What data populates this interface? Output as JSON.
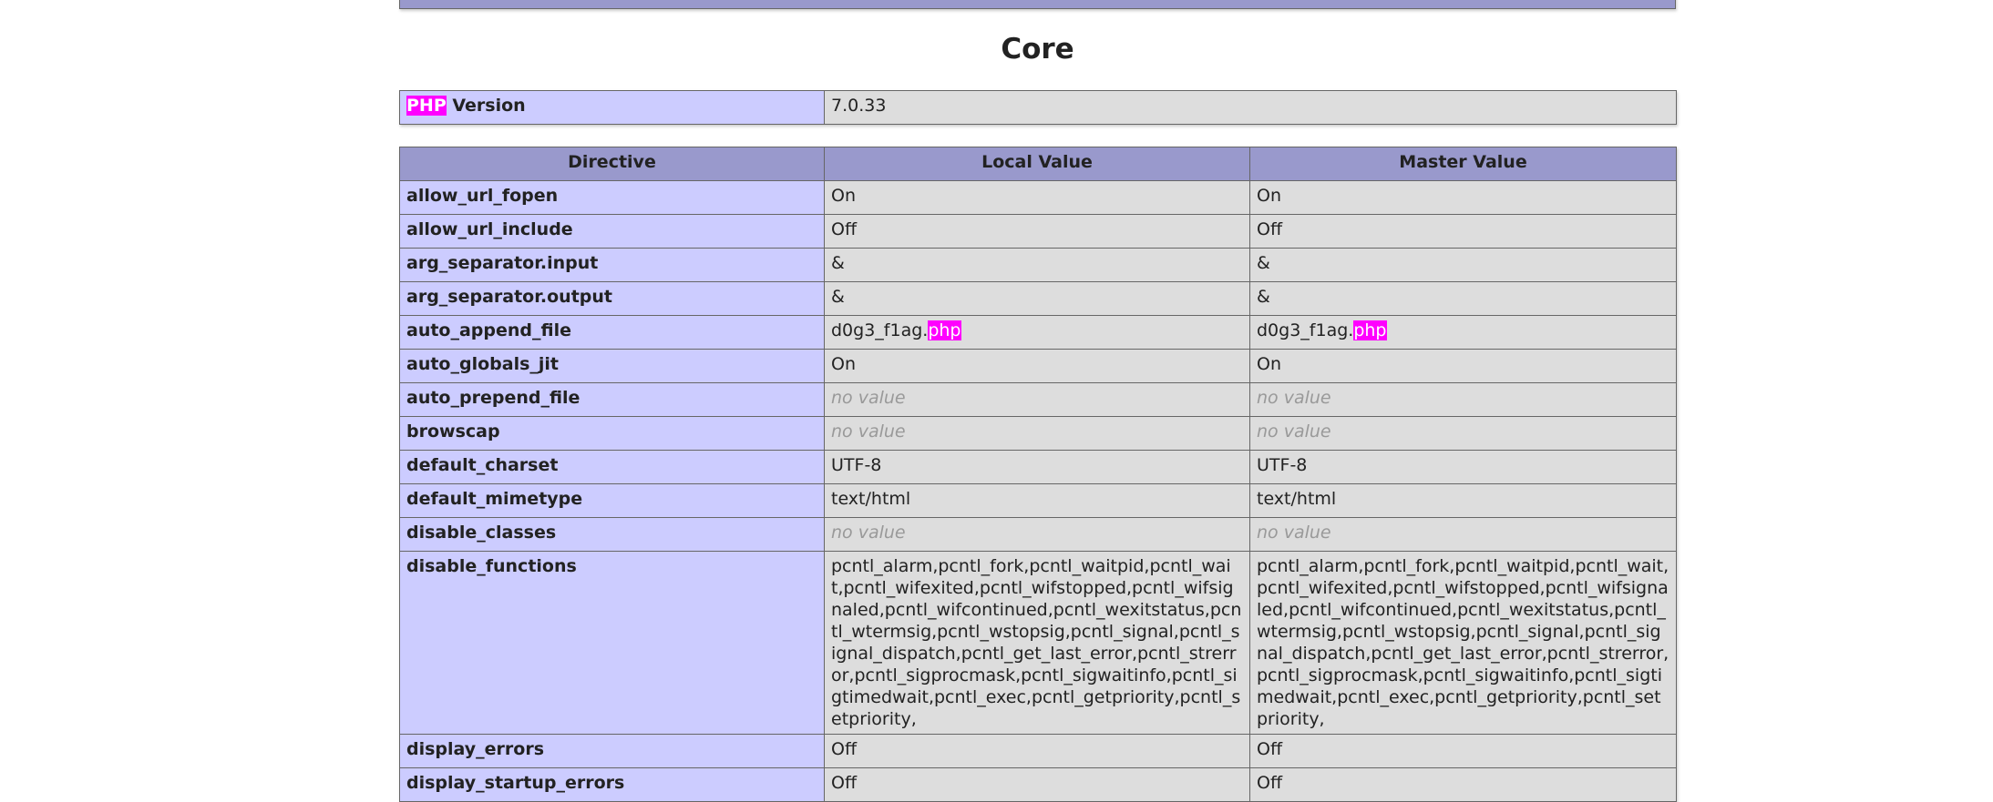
{
  "section": {
    "title": "Core"
  },
  "version": {
    "label_highlight": "PHP",
    "label_rest": " Version",
    "value": "7.0.33"
  },
  "table": {
    "headers": [
      "Directive",
      "Local Value",
      "Master Value"
    ],
    "no_value": "no value",
    "rows": [
      {
        "name": "allow_url_fopen",
        "local": "On",
        "master": "On"
      },
      {
        "name": "allow_url_include",
        "local": "Off",
        "master": "Off"
      },
      {
        "name": "arg_separator.input",
        "local": "&",
        "master": "&"
      },
      {
        "name": "arg_separator.output",
        "local": "&",
        "master": "&"
      },
      {
        "name": "auto_append_file",
        "local_prefix": "d0g3_f1ag.",
        "local_hl": "php",
        "master_prefix": "d0g3_f1ag.",
        "master_hl": "php"
      },
      {
        "name": "auto_globals_jit",
        "local": "On",
        "master": "On"
      },
      {
        "name": "auto_prepend_file",
        "local": "no value",
        "master": "no value"
      },
      {
        "name": "browscap",
        "local": "no value",
        "master": "no value"
      },
      {
        "name": "default_charset",
        "local": "UTF-8",
        "master": "UTF-8"
      },
      {
        "name": "default_mimetype",
        "local": "text/html",
        "master": "text/html"
      },
      {
        "name": "disable_classes",
        "local": "no value",
        "master": "no value"
      },
      {
        "name": "disable_functions",
        "local": "pcntl_alarm,pcntl_fork,pcntl_waitpid,pcntl_wait,pcntl_wifexited,pcntl_wifstopped,pcntl_wifsignaled,pcntl_wifcontinued,pcntl_wexitstatus,pcntl_wtermsig,pcntl_wstopsig,pcntl_signal,pcntl_signal_dispatch,pcntl_get_last_error,pcntl_strerror,pcntl_sigprocmask,pcntl_sigwaitinfo,pcntl_sigtimedwait,pcntl_exec,pcntl_getpriority,pcntl_setpriority,",
        "master": "pcntl_alarm,pcntl_fork,pcntl_waitpid,pcntl_wait,pcntl_wifexited,pcntl_wifstopped,pcntl_wifsignaled,pcntl_wifcontinued,pcntl_wexitstatus,pcntl_wtermsig,pcntl_wstopsig,pcntl_signal,pcntl_signal_dispatch,pcntl_get_last_error,pcntl_strerror,pcntl_sigprocmask,pcntl_sigwaitinfo,pcntl_sigtimedwait,pcntl_exec,pcntl_getpriority,pcntl_setpriority,"
      },
      {
        "name": "display_errors",
        "local": "Off",
        "master": "Off"
      },
      {
        "name": "display_startup_errors",
        "local": "Off",
        "master": "Off"
      }
    ]
  }
}
